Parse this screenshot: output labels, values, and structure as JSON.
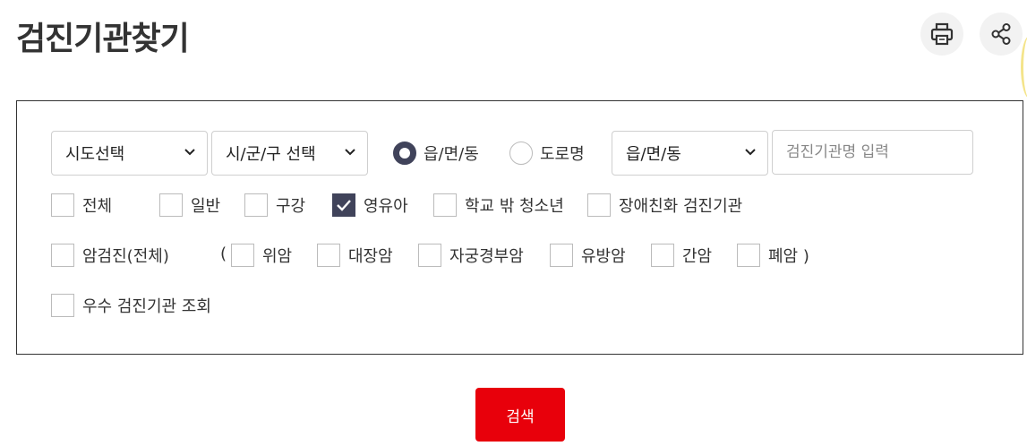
{
  "page": {
    "title": "검진기관찾기"
  },
  "toolbar": {
    "print_icon": "print-icon",
    "share_icon": "share-icon"
  },
  "filters": {
    "sido_select": {
      "value": "시도선택"
    },
    "sigungu_select": {
      "value": "시/군/구 선택"
    },
    "address_type": {
      "options": [
        {
          "label": "읍/면/동",
          "checked": true
        },
        {
          "label": "도로명",
          "checked": false
        }
      ]
    },
    "emd_select": {
      "value": "읍/면/동"
    },
    "institution_input": {
      "placeholder": "검진기관명 입력",
      "value": ""
    },
    "types_row": [
      {
        "label": "전체",
        "checked": false
      },
      {
        "label": "일반",
        "checked": false
      },
      {
        "label": "구강",
        "checked": false
      },
      {
        "label": "영유아",
        "checked": true
      },
      {
        "label": "학교 밖 청소년",
        "checked": false
      },
      {
        "label": "장애친화 검진기관",
        "checked": false
      }
    ],
    "cancer_row": {
      "all": {
        "label": "암검진(전체)",
        "checked": false
      },
      "paren_open": "(",
      "items": [
        {
          "label": "위암",
          "checked": false
        },
        {
          "label": "대장암",
          "checked": false
        },
        {
          "label": "자궁경부암",
          "checked": false
        },
        {
          "label": "유방암",
          "checked": false
        },
        {
          "label": "간암",
          "checked": false
        },
        {
          "label": "폐암 )",
          "checked": false
        }
      ]
    },
    "excellent": {
      "label": "우수 검진기관 조회",
      "checked": false
    }
  },
  "actions": {
    "search_label": "검색"
  },
  "colors": {
    "accent": "#40435a",
    "search_button": "#e8000b",
    "border": "#333333"
  }
}
